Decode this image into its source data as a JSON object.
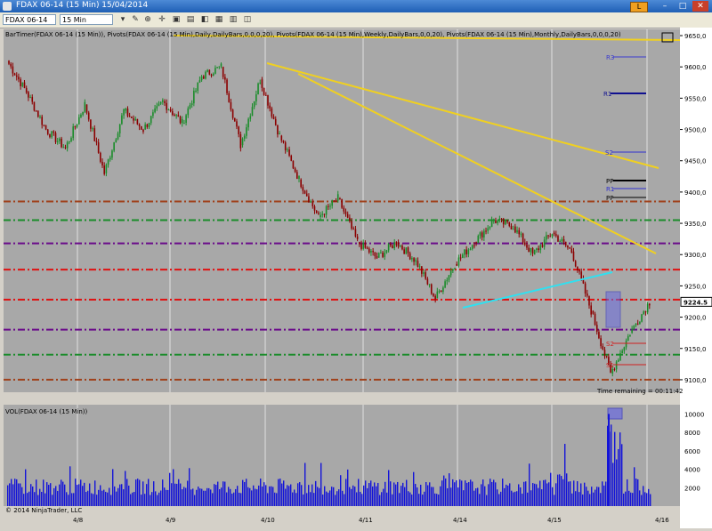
{
  "window": {
    "title": "FDAX 06-14 (15 Min)   15/04/2014",
    "badge": "L",
    "controls": {
      "minimize": "–",
      "maximize": "□",
      "close": "✕"
    }
  },
  "toolbar": {
    "instrument": "FDAX 06-14",
    "interval": "15 Min",
    "icons": [
      "dropdown-icon",
      "pencil-icon",
      "zoom-in-icon",
      "zoom-out-icon",
      "crosshair-icon",
      "properties-icon",
      "indicators-icon",
      "strategies-icon",
      "print-icon",
      "save-icon",
      "refresh-icon",
      "data-box-icon"
    ]
  },
  "chart": {
    "indicator_legend": "BarTimer(FDAX 06-14 (15 Min)), Pivots(FDAX 06-14 (15 Min),Daily,DailyBars,0,0,0,20), Pivots(FDAX 06-14 (15 Min),Weekly,DailyBars,0,0,20), Pivots(FDAX 06-14 (15 Min),Monthly,DailyBars,0,0,0,20)",
    "volume_legend": "VOL(FDAX 06-14 (15 Min))",
    "copyright": "© 2014 NinjaTrader, LLC",
    "time_remaining": "Time remaining = 00:11:42",
    "last_price": "9224.5",
    "price_axis": [
      "9650,0",
      "9600,0",
      "9550,0",
      "9500,0",
      "9450,0",
      "9400,0",
      "9350,0",
      "9300,0",
      "9250,0",
      "9200,0",
      "9150,0",
      "9100,0"
    ],
    "volume_axis": [
      "10000",
      "8000",
      "6000",
      "4000",
      "2000"
    ],
    "date_labels": [
      "4/8",
      "4/9",
      "4/10",
      "4/11",
      "4/14",
      "4/15",
      "4/16"
    ],
    "pivot_labels": [
      "R3",
      "R1",
      "S2",
      "PP",
      "R1",
      "PP",
      "S2",
      "S1"
    ],
    "colors": {
      "background": "#a8a8a8",
      "up_bar": "#1a8c2a",
      "down_bar": "#8b0000",
      "volume": "#1414d8",
      "trendline": "#f0d020",
      "cyan_line": "#30e0f0",
      "level_brown": "#a0401a",
      "level_green": "#1a8c2a",
      "level_purple": "#6a0a8a",
      "level_red": "#e01010"
    }
  },
  "chart_data": {
    "type": "line",
    "title": "",
    "instrument": "FDAX 06-14",
    "interval": "15 Min",
    "ylim": [
      9080,
      9660
    ],
    "volume_ylim": [
      0,
      11000
    ],
    "close_path": [
      {
        "x": "4/7 open",
        "y": 9610
      },
      {
        "x": "4/7 a",
        "y": 9560
      },
      {
        "x": "4/7 b",
        "y": 9500
      },
      {
        "x": "4/7 c",
        "y": 9470
      },
      {
        "x": "4/8 a",
        "y": 9540
      },
      {
        "x": "4/8 b",
        "y": 9430
      },
      {
        "x": "4/8 c",
        "y": 9530
      },
      {
        "x": "4/9 a",
        "y": 9500
      },
      {
        "x": "4/9 b",
        "y": 9545
      },
      {
        "x": "4/9 c",
        "y": 9510
      },
      {
        "x": "4/9 d",
        "y": 9585
      },
      {
        "x": "4/10 a",
        "y": 9600
      },
      {
        "x": "4/10 b",
        "y": 9475
      },
      {
        "x": "4/10 c",
        "y": 9580
      },
      {
        "x": "4/10 d",
        "y": 9490
      },
      {
        "x": "4/10 e",
        "y": 9420
      },
      {
        "x": "4/11 a",
        "y": 9360
      },
      {
        "x": "4/11 b",
        "y": 9390
      },
      {
        "x": "4/11 c",
        "y": 9320
      },
      {
        "x": "4/11 d",
        "y": 9295
      },
      {
        "x": "4/11 e",
        "y": 9320
      },
      {
        "x": "4/14 a",
        "y": 9290
      },
      {
        "x": "4/14 b",
        "y": 9230
      },
      {
        "x": "4/14 c",
        "y": 9285
      },
      {
        "x": "4/14 d",
        "y": 9320
      },
      {
        "x": "4/14 e",
        "y": 9355
      },
      {
        "x": "4/15 a",
        "y": 9345
      },
      {
        "x": "4/15 b",
        "y": 9300
      },
      {
        "x": "4/15 c",
        "y": 9335
      },
      {
        "x": "4/15 d",
        "y": 9305
      },
      {
        "x": "4/15 e",
        "y": 9210
      },
      {
        "x": "4/15 f",
        "y": 9110
      },
      {
        "x": "4/15 g",
        "y": 9175
      },
      {
        "x": "4/15 last",
        "y": 9224.5
      }
    ],
    "horizontal_levels": [
      {
        "y": 9385,
        "color": "brown"
      },
      {
        "y": 9355,
        "color": "green"
      },
      {
        "y": 9318,
        "color": "purple"
      },
      {
        "y": 9276,
        "color": "red"
      },
      {
        "y": 9228,
        "color": "red"
      },
      {
        "y": 9180,
        "color": "purple"
      },
      {
        "y": 9140,
        "color": "green"
      },
      {
        "y": 9100,
        "color": "brown"
      }
    ],
    "volume": [
      {
        "x": "4/8",
        "y": 2500
      },
      {
        "x": "4/9",
        "y": 2800
      },
      {
        "x": "4/10",
        "y": 4000
      },
      {
        "x": "4/11",
        "y": 4500
      },
      {
        "x": "4/14",
        "y": 3200
      },
      {
        "x": "4/15",
        "y": 5000
      },
      {
        "x": "4/15 peak",
        "y": 10000
      }
    ],
    "legend": "top-left",
    "grid": false
  }
}
